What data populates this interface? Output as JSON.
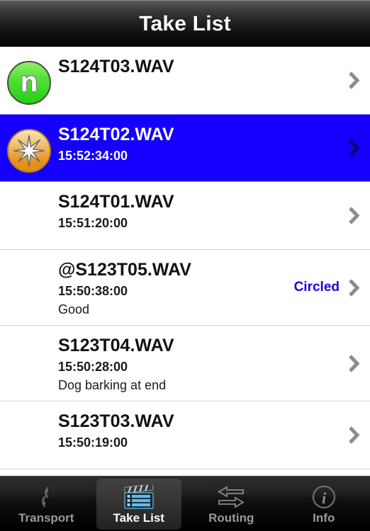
{
  "header": {
    "title": "Take List"
  },
  "list": {
    "rows": [
      {
        "filename": "S124T03.WAV",
        "timestamp": "",
        "note": "",
        "status": "",
        "badge": "n",
        "badge_kind": "green-letter",
        "selected": false
      },
      {
        "filename": "S124T02.WAV",
        "timestamp": "15:52:34:00",
        "note": "",
        "status": "",
        "badge": "star",
        "badge_kind": "gold-star",
        "selected": true
      },
      {
        "filename": "S124T01.WAV",
        "timestamp": "15:51:20:00",
        "note": "",
        "status": "",
        "badge": "",
        "badge_kind": "none",
        "selected": false
      },
      {
        "filename": "@S123T05.WAV",
        "timestamp": "15:50:38:00",
        "note": "Good",
        "status": "Circled",
        "badge": "",
        "badge_kind": "none",
        "selected": false
      },
      {
        "filename": "S123T04.WAV",
        "timestamp": "15:50:28:00",
        "note": "Dog barking at end",
        "status": "",
        "badge": "",
        "badge_kind": "none",
        "selected": false
      },
      {
        "filename": "S123T03.WAV",
        "timestamp": "15:50:19:00",
        "note": "",
        "status": "",
        "badge": "",
        "badge_kind": "none",
        "selected": false
      }
    ]
  },
  "tabbar": {
    "tabs": [
      {
        "label": "Transport",
        "icon": "reel-icon",
        "active": false
      },
      {
        "label": "Take List",
        "icon": "clapperboard-icon",
        "active": true
      },
      {
        "label": "Routing",
        "icon": "swap-arrows-icon",
        "active": false
      },
      {
        "label": "Info",
        "icon": "info-circle-icon",
        "active": false
      }
    ]
  },
  "colors": {
    "selected_row": "#1400fc",
    "status_text": "#2200dd",
    "badge_green": "#3fd520",
    "badge_gold": "#ea9a22",
    "chevron": "#8c8c8c",
    "chevron_selected": "#0a0a6e"
  }
}
